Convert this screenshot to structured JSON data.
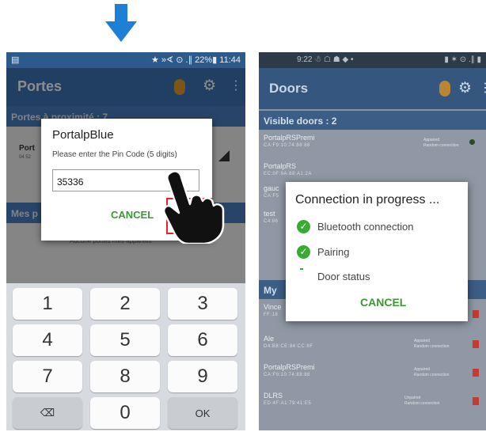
{
  "left_screen": {
    "status_bar": {
      "right_text": "★ »∢ ⊙ .∥ 22%▮ 11:44"
    },
    "app_title": "Portes",
    "section1_header": "Portes à proximité : 7",
    "list_item": {
      "name": "Port",
      "id": "04 52"
    },
    "section2_header": "Mes p",
    "background_text": "Aucune portes mes appareils",
    "dialog": {
      "title": "PortalpBlue",
      "message": "Please enter the Pin Code (5 digits)",
      "pin_value": "35336",
      "cancel_label": "CANCEL",
      "ok_label": "OK"
    },
    "keyboard": {
      "keys": [
        "1",
        "2",
        "3",
        "4",
        "5",
        "6",
        "7",
        "8",
        "9",
        "⌫",
        "0",
        "OK"
      ]
    }
  },
  "right_screen": {
    "status_bar": {
      "left_text": "9:22 ☃ ☖ ☗ ◆ •",
      "right_text": "▮ ✶ ⊙ .∥ ▮"
    },
    "app_title": "Doors",
    "visible_header": "Visible doors : 2",
    "visible_items": [
      {
        "name": "PortalpRSPremi",
        "id": "CA:F9:10:74:88:88",
        "status_line1": "Appaired",
        "status_line2": "Random connection"
      },
      {
        "name": "PortalpRS",
        "id": "EC:0F:9A:88:A1:2A"
      },
      {
        "name": "gauc",
        "id": "CA:F5"
      },
      {
        "name": "test",
        "id": "C4:86"
      }
    ],
    "my_header": "My",
    "my_items": [
      {
        "name": "Vince",
        "id": "FF:18"
      },
      {
        "name": "Ale",
        "id": "D4:B8:CE:84:CC:8F",
        "status_line1": "Appaired",
        "status_line2": "Random connection"
      },
      {
        "name": "PortalpRSPremi",
        "id": "CA:F9:10:74:88:88",
        "status_line1": "Appaired",
        "status_line2": "Random connection"
      },
      {
        "name": "DLRS",
        "id": "ED:4F:A1:79:41:E5",
        "status_line1": "Unpaired",
        "status_line2": "Random connection"
      }
    ],
    "dialog": {
      "title": "Connection in progress ...",
      "steps": [
        {
          "label": "Bluetooth connection",
          "state": "done"
        },
        {
          "label": "Pairing",
          "state": "done"
        },
        {
          "label": "Door status",
          "state": "pending"
        }
      ],
      "cancel_label": "CANCEL"
    }
  },
  "colors": {
    "arrow_blue": "#1e7fd6",
    "app_blue": "#3d74b5",
    "ok_green": "#3a9a32",
    "highlight_red": "#e0262b",
    "trash_red": "#c63a33"
  },
  "icons": [
    "down-arrow-icon",
    "bluetooth-icon",
    "gear-icon",
    "overflow-menu-icon",
    "signal-icon",
    "backspace-icon",
    "pointing-hand-icon",
    "check-circle-icon",
    "trash-icon"
  ]
}
